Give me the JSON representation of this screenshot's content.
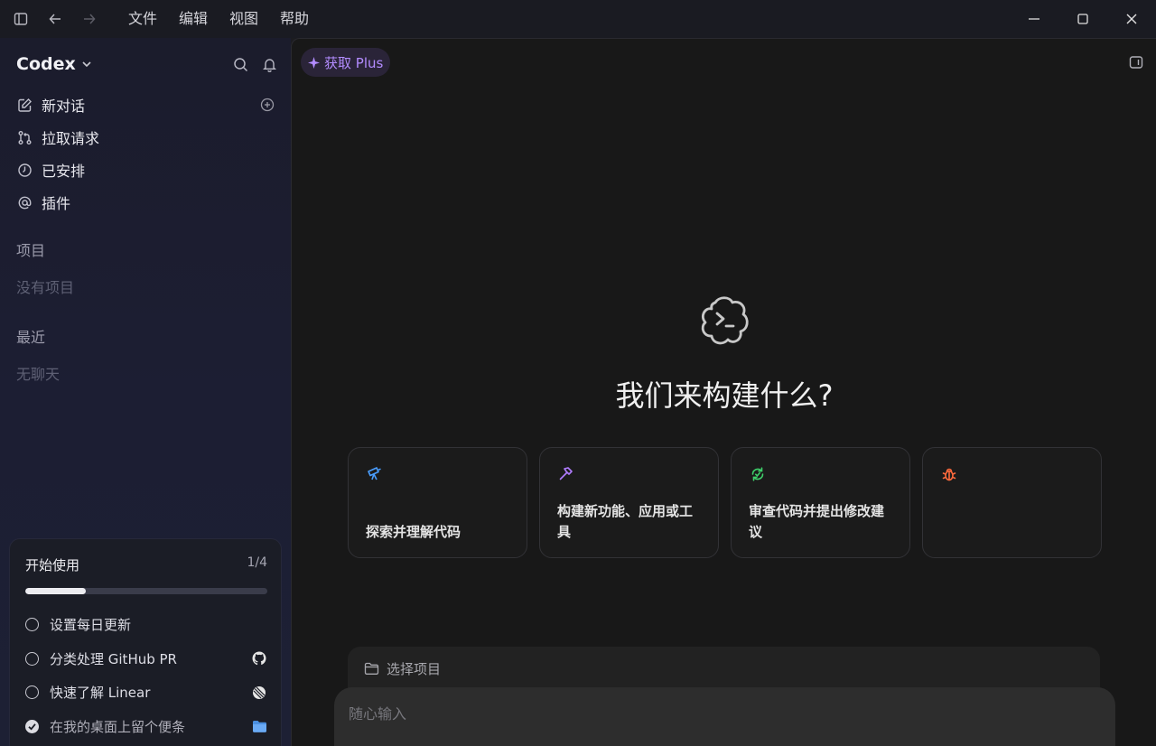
{
  "titlebar": {
    "menu": [
      "文件",
      "编辑",
      "视图",
      "帮助"
    ]
  },
  "sidebar": {
    "brand": "Codex",
    "nav": [
      {
        "label": "新对话",
        "icon": "edit-icon"
      },
      {
        "label": "拉取请求",
        "icon": "pull-request-icon"
      },
      {
        "label": "已安排",
        "icon": "clock-icon"
      },
      {
        "label": "插件",
        "icon": "at-icon"
      }
    ],
    "projects_heading": "项目",
    "projects_empty": "没有项目",
    "recent_heading": "最近",
    "recent_empty": "无聊天"
  },
  "getting_started": {
    "title": "开始使用",
    "count": "1/4",
    "progress": 0.25,
    "items": [
      {
        "label": "设置每日更新",
        "done": false,
        "icon": ""
      },
      {
        "label": "分类处理 GitHub PR",
        "done": false,
        "icon": "github-icon"
      },
      {
        "label": "快速了解 Linear",
        "done": false,
        "icon": "linear-icon"
      },
      {
        "label": "在我的桌面上留个便条",
        "done": true,
        "icon": "folder-icon"
      }
    ]
  },
  "main": {
    "plus_label": "获取 Plus",
    "hero_title": "我们来构建什么?",
    "cards": [
      {
        "label": "探索并理解代码",
        "icon": "telescope-icon",
        "color": "#4a9eff"
      },
      {
        "label": "构建新功能、应用或工具",
        "icon": "hammer-icon",
        "color": "#b07cff"
      },
      {
        "label": "审查代码并提出修改建议",
        "icon": "review-icon",
        "color": "#3ecf6a"
      },
      {
        "label": "",
        "icon": "bug-icon",
        "color": "#ff6a3d"
      }
    ],
    "project_selector": "选择项目",
    "composer_placeholder": "随心输入"
  },
  "colors": {
    "accent_purple": "#b38cff",
    "sidebar_bg": "#1c1e33",
    "main_bg": "#181818"
  }
}
